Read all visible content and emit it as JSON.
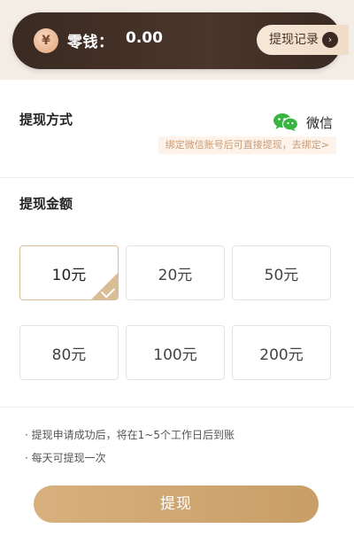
{
  "wallet": {
    "coin_symbol": "¥",
    "balance_label": "零钱：",
    "balance_value": "0.00",
    "history_label": "提现记录",
    "history_arrow": "›"
  },
  "withdraw_method": {
    "title": "提现方式",
    "method_label": "微信",
    "bind_tip": "绑定微信账号后可直接提现，去绑定>"
  },
  "withdraw_amount": {
    "title": "提现金额",
    "options": [
      {
        "label": "10元",
        "selected": true
      },
      {
        "label": "20元",
        "selected": false
      },
      {
        "label": "50元",
        "selected": false
      },
      {
        "label": "80元",
        "selected": false
      },
      {
        "label": "100元",
        "selected": false
      },
      {
        "label": "200元",
        "selected": false
      }
    ]
  },
  "notes": [
    "· 提现申请成功后，将在1~5个工作日后到账",
    "· 每天可提现一次"
  ],
  "withdraw_button": "提现",
  "colors": {
    "accent": "#c99e67",
    "wallet_bg": "#3a2a22",
    "wechat_green": "#38b540"
  },
  "icons": {
    "coin": "coin-icon",
    "wechat": "wechat-icon",
    "history_arrow": "chevron-right-icon",
    "selected_check": "check-icon"
  }
}
